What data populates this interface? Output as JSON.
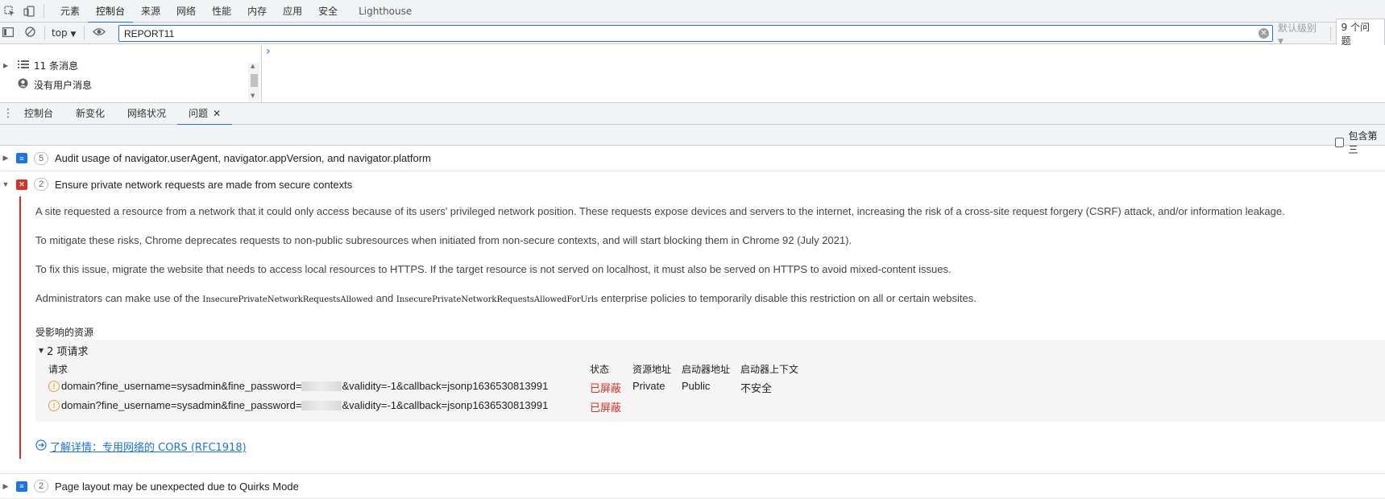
{
  "main_tabs": [
    "元素",
    "控制台",
    "来源",
    "网络",
    "性能",
    "内存",
    "应用",
    "安全",
    "Lighthouse"
  ],
  "active_main_tab": "控制台",
  "console_toolbar": {
    "context": "top",
    "filter_value": "REPORT11",
    "level": "默认级别",
    "issues_count": "9 个问题"
  },
  "sidebar": {
    "messages": "11 条消息",
    "user_messages": "没有用户消息"
  },
  "drawer_tabs": [
    "控制台",
    "新变化",
    "网络状况",
    "问题"
  ],
  "active_drawer_tab": "问题",
  "issues_toolbar": {
    "include_third_party": "包含第三"
  },
  "issues": [
    {
      "count": "5",
      "title": "Audit usage of navigator.userAgent, navigator.appVersion, and navigator.platform",
      "kind": "info"
    },
    {
      "count": "2",
      "title": "Ensure private network requests are made from secure contexts",
      "kind": "error"
    },
    {
      "count": "2",
      "title": "Page layout may be unexpected due to Quirks Mode",
      "kind": "info"
    }
  ],
  "detail": {
    "p1": "A site requested a resource from a network that it could only access because of its users' privileged network position. These requests expose devices and servers to the internet, increasing the risk of a cross-site request forgery (CSRF) attack, and/or information leakage.",
    "p2": "To mitigate these risks, Chrome deprecates requests to non-public subresources when initiated from non-secure contexts, and will start blocking them in Chrome 92 (July 2021).",
    "p3": "To fix this issue, migrate the website that needs to access local resources to HTTPS. If the target resource is not served on localhost, it must also be served on HTTPS to avoid mixed-content issues.",
    "p4_pre": "Administrators can make use of the",
    "p4_code1": "InsecurePrivateNetworkRequestsAllowed",
    "p4_mid": "and",
    "p4_code2": "InsecurePrivateNetworkRequestsAllowedForUrls",
    "p4_post": "enterprise policies to temporarily disable this restriction on all or certain websites.",
    "affected_label": "受影响的资源",
    "requests_label": "2 项请求",
    "columns": [
      "请求",
      "状态",
      "资源地址",
      "启动器地址",
      "启动器上下文"
    ],
    "rows": [
      {
        "req_a": "domain?fine_username=sysadmin&fine_password=",
        "req_b": "&validity=-1&callback=jsonp1636530813991",
        "status": "已屏蔽",
        "resource": "Private",
        "initiator": "Public",
        "context": "不安全"
      },
      {
        "req_a": "domain?fine_username=sysadmin&fine_password=",
        "req_b": "&validity=-1&callback=jsonp1636530813991",
        "status": "已屏蔽",
        "resource": "",
        "initiator": "",
        "context": ""
      }
    ],
    "learn_more": "了解详情：专用网络的 CORS (RFC1918)"
  },
  "colors": {
    "accent": "#1a73e8",
    "error": "#d93025",
    "info": "#1a73e8"
  }
}
